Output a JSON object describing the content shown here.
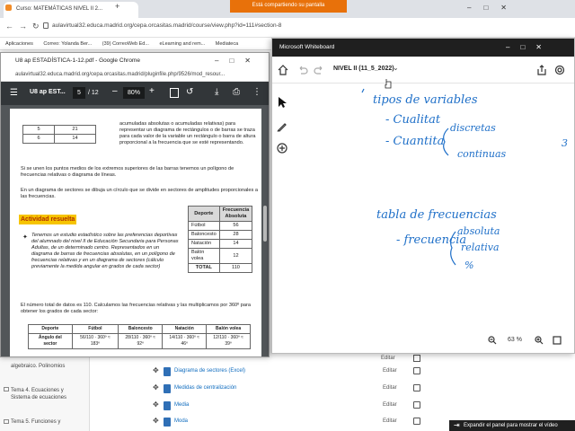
{
  "browser": {
    "tab_title": "Curso: MATEMÁTICAS NIVEL II 2...",
    "share_banner": "Está compartiendo su pantalla",
    "url": "aulavirtual32.educa.madrid.org/cepa.orcasitas.madrid/course/view.php?id=111#section-8",
    "bookmarks": [
      "Aplicaciones",
      "Correo: Yolanda Ber...",
      "(39) CorreoWeb Ed...",
      "eLearning and rem...",
      "Mediateca"
    ]
  },
  "pdf_window": {
    "title": "U8 ap ESTADÍSTICA-1-12.pdf - Google Chrome",
    "url": "aulavirtual32.educa.madrid.org/cepa.orcasitas.madrid/pluginfile.php/9526/mod_resour...",
    "doc_name": "U8 ap EST...",
    "page_current": "5",
    "page_total": "/ 12",
    "zoom": "80%",
    "top_table": [
      [
        "5",
        "21"
      ],
      [
        "6",
        "14"
      ]
    ],
    "text_1": "acumuladas absolutas o acumuladas relativas) para representar un diagrama de rectángulos o de barras se traza para cada valor de la variable un rectángulo o barra de altura proporcional a la frecuencia que se esté representando.",
    "text_2": "Si se unen los puntos medios de los extremos superiores de las barras tenemos un polígono de frecuencias relativas o diagrama de líneas.",
    "text_3": "En un diagrama de sectores se dibuja un círculo que se divide en sectores de amplitudes proporcionales a las frecuencias.",
    "activity_title": "Actividad resuelta",
    "activity_text": "Tenemos un estudio estadístico sobre las preferencias deportivas del alumnado del nivel II de Educación Secundaria para Personas Adultas, de un determinado centro. Representados en un diagrama de barras de frecuencias absolutas, en un polígono de frecuencias relativas y en un diagrama de sectores (cálculo previamente la medida angular en grados de cada sector)",
    "sports_table": {
      "headers": [
        "Deporte",
        "Frecuencia Absoluta"
      ],
      "rows": [
        [
          "Fútbol",
          "56"
        ],
        [
          "Baloncesto",
          "28"
        ],
        [
          "Natación",
          "14"
        ],
        [
          "Balón volea",
          "12"
        ],
        [
          "TOTAL",
          "110"
        ]
      ]
    },
    "text_4": "El número total de datos es 110. Calculamos las frecuencias relativas y las multiplicamos por 360º para obtener los grados de cada sector:",
    "angle_table": {
      "headers": [
        "Deporte",
        "Fútbol",
        "Baloncesto",
        "Natación",
        "Balón volea"
      ],
      "row_label": "Ángulo del sector",
      "cells": [
        "56/110 · 360º ≈ 183º",
        "28/110 · 360º ≈ 92º",
        "14/110 · 360º ≈ 46º",
        "12/110 · 360º ≈ 39º"
      ]
    }
  },
  "whiteboard": {
    "title": "Microsoft Whiteboard",
    "board_name": "NIVEL II (11_5_2022)",
    "zoom": "63 %",
    "handwriting": [
      "tipos de variables",
      "- Cualitat",
      "- Cuantita",
      "discretas",
      "continuas",
      "tabla de frecuencias",
      "- frecuencia",
      "absoluta",
      "relativa",
      "%",
      "3"
    ]
  },
  "moodle": {
    "sidebar": [
      "algebraico. Polinomios",
      "Tema 4. Ecuaciones y Sistema de ecuaciones",
      "Tema 5. Funciones y"
    ],
    "rows": [
      {
        "label": "Diagrama de sectores (Excel)",
        "edit": "Editar"
      },
      {
        "label": "Medidas de centralización",
        "edit": "Editar"
      },
      {
        "label": "Media",
        "edit": "Editar"
      },
      {
        "label": "Moda",
        "edit": "Editar"
      }
    ],
    "top_edit": "Editar",
    "expand_tip": "Expandir el panel para mostrar el vídeo"
  }
}
